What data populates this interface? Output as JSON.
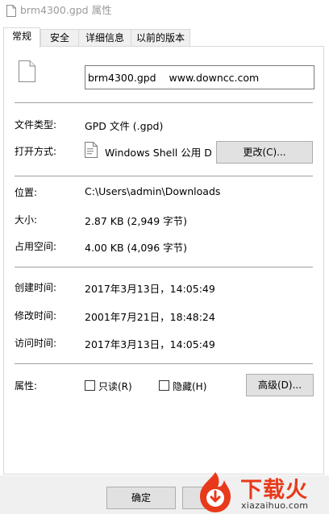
{
  "window": {
    "title": "brm4300.gpd 属性"
  },
  "tabs": [
    {
      "label": "常规",
      "active": true
    },
    {
      "label": "安全",
      "active": false
    },
    {
      "label": "详细信息",
      "active": false
    },
    {
      "label": "以前的版本",
      "active": false
    }
  ],
  "general": {
    "file_name": "brm4300.gpd    www.downcc.com",
    "type_label": "文件类型:",
    "type_value": "GPD 文件 (.gpd)",
    "opens_with_label": "打开方式:",
    "opens_with_value": "Windows Shell 公用 DLL",
    "change_button": "更改(C)...",
    "location_label": "位置:",
    "location_value": "C:\\Users\\admin\\Downloads",
    "size_label": "大小:",
    "size_value": "2.87 KB (2,949 字节)",
    "size_on_disk_label": "占用空间:",
    "size_on_disk_value": "4.00 KB (4,096 字节)",
    "created_label": "创建时间:",
    "created_value": "2017年3月13日，14:05:49",
    "modified_label": "修改时间:",
    "modified_value": "2001年7月21日，18:48:24",
    "accessed_label": "访问时间:",
    "accessed_value": "2017年3月13日，14:05:49",
    "attributes_label": "属性:",
    "readonly_label": "只读(R)",
    "readonly_checked": false,
    "hidden_label": "隐藏(H)",
    "hidden_checked": false,
    "advanced_button": "高级(D)..."
  },
  "footer": {
    "ok_button": "确定"
  },
  "watermark": {
    "brand": "下载火",
    "url": "xiazaihuo.com"
  },
  "colors": {
    "watermark_accent": "#e8391a",
    "tab_border": "#d9d9d9",
    "button_face": "#e1e1e1"
  }
}
